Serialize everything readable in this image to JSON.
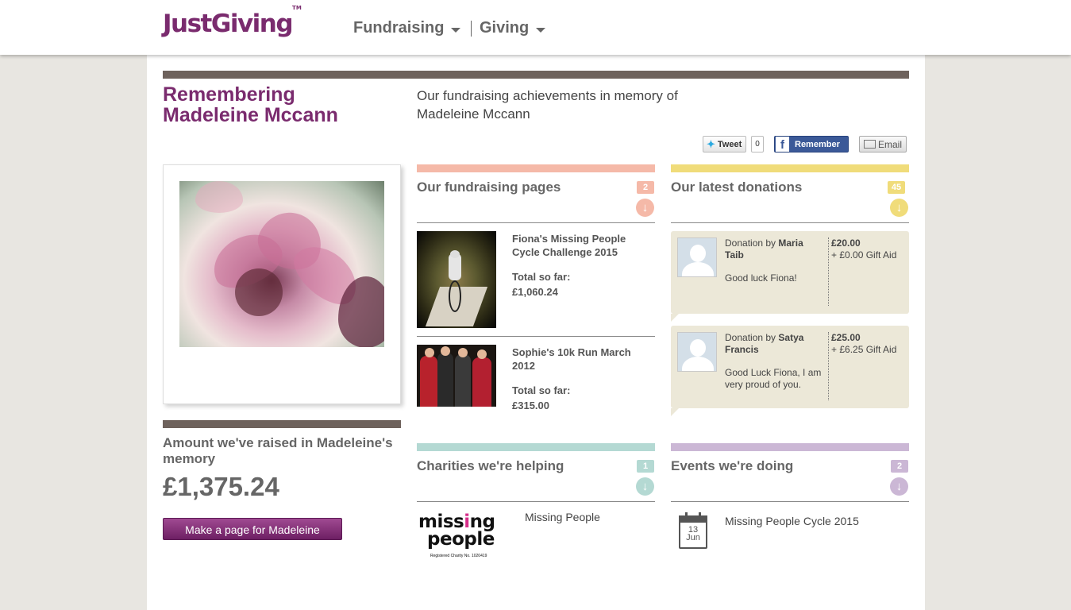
{
  "header": {
    "logo": "JustGiving",
    "logo_tm": "TM",
    "nav": [
      {
        "label": "Fundraising"
      },
      {
        "label": "Giving"
      }
    ]
  },
  "page": {
    "title": "Remembering Madeleine Mccann",
    "intro": "Our fundraising achievements in memory of Madeleine Mccann"
  },
  "share": {
    "tweet_label": "Tweet",
    "tweet_count": "0",
    "facebook_label": "Remember",
    "email_label": "Email"
  },
  "amount": {
    "label": "Amount we've raised in Madeleine's memory",
    "value": "£1,375.24",
    "cta": "Make a page for Madeleine"
  },
  "fundraising": {
    "heading": "Our fundraising pages",
    "count": "2",
    "pages": [
      {
        "title": "Fiona's Missing People Cycle Challenge 2015",
        "total_label": "Total so far:",
        "total": "£1,060.24"
      },
      {
        "title": "Sophie's 10k Run March 2012",
        "total_label": "Total so far:",
        "total": "£315.00"
      }
    ]
  },
  "donations": {
    "heading": "Our latest donations",
    "count": "45",
    "items": [
      {
        "prefix": "Donation by ",
        "name": "Maria Taib",
        "message": "Good luck Fiona!",
        "amount": "£20.00",
        "gift_aid": "+ £0.00 Gift Aid"
      },
      {
        "prefix": "Donation by ",
        "name": "Satya Francis",
        "message": "Good Luck Fiona, I am very proud of you.",
        "amount": "£25.00",
        "gift_aid": "+ £6.25 Gift Aid"
      }
    ]
  },
  "charities": {
    "heading": "Charities we're helping",
    "count": "1",
    "logo_line1": "missing",
    "logo_line2": "people",
    "logo_small": "Registered Charity No. 1020419",
    "name": "Missing People"
  },
  "events": {
    "heading": "Events we're doing",
    "count": "2",
    "cal_day": "13",
    "cal_month": "Jun",
    "name": "Missing People Cycle 2015"
  },
  "colors": {
    "brand": "#7a2b6e",
    "fundraising": "#f5b9a8",
    "donations": "#f0dc7a",
    "charities": "#b4d9d3",
    "events": "#cbb7d5",
    "divider": "#6e625c"
  },
  "icons": [
    "caret-down-icon",
    "twitter-bird-icon",
    "facebook-icon",
    "envelope-icon",
    "arrow-down-icon",
    "calendar-icon",
    "avatar-placeholder-icon"
  ]
}
